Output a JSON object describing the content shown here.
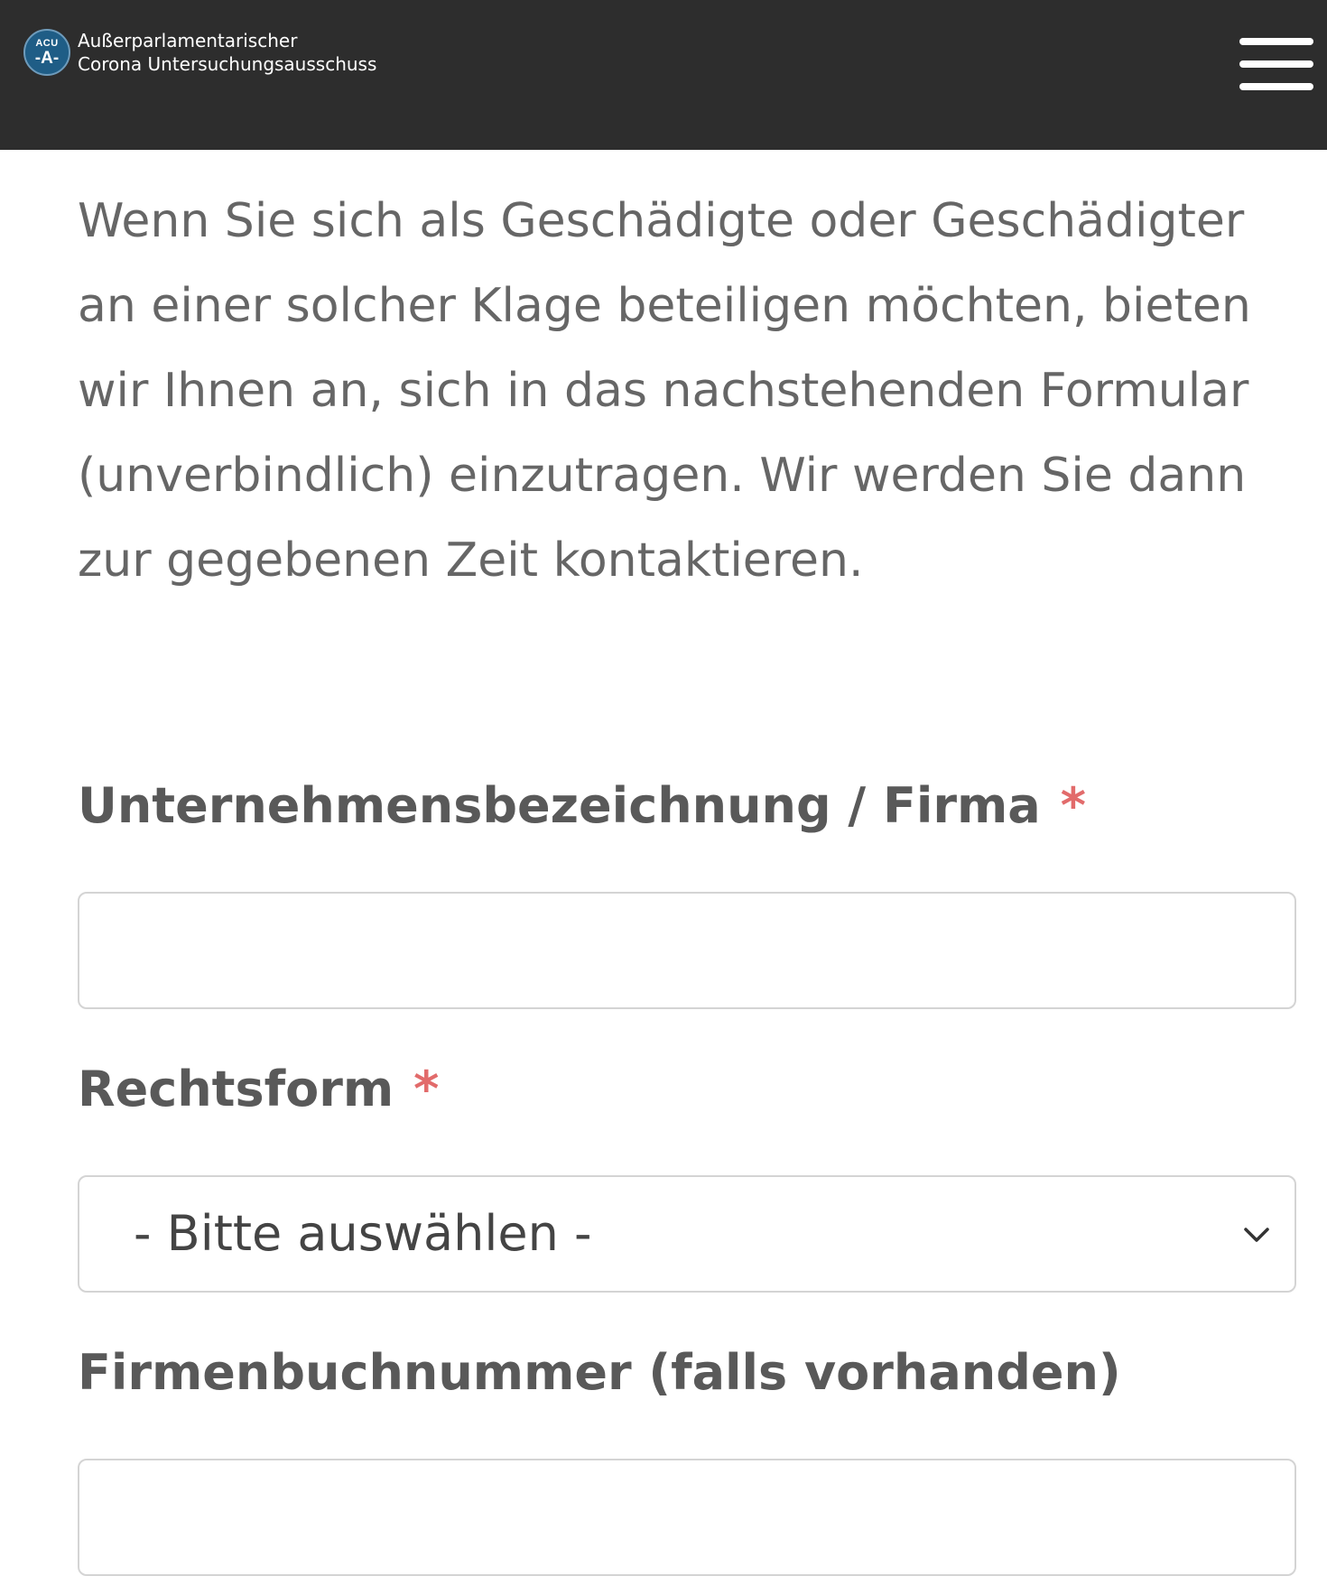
{
  "header": {
    "logo_badge_top": "ACU",
    "logo_badge_bottom": "-A-",
    "title_line1": "Außerparlamentarischer",
    "title_line2": "Corona Untersuchungsausschuss",
    "menu_icon": "hamburger-menu-icon",
    "background_color": "#2d2d2d",
    "logo_color": "#1f5d86"
  },
  "intro": {
    "text": "Wenn Sie sich als Geschädigte oder Geschädigter an einer solcher Klage beteiligen möchten, bieten wir Ihnen an, sich in das nachstehenden Formular (unverbindlich) einzutragen. Wir werden Sie dann zur gegebenen Zeit kontaktieren."
  },
  "form": {
    "company": {
      "label": "Unternehmensbezeichnung / Firma",
      "required_mark": "*",
      "value": ""
    },
    "legal_form": {
      "label": "Rechtsform",
      "required_mark": "*",
      "selected": "- Bitte auswählen -",
      "icon": "chevron-down-icon"
    },
    "register_number": {
      "label": "Firmenbuchnummer (falls vorhanden)",
      "value": ""
    },
    "required_color": "#e26b6b"
  }
}
